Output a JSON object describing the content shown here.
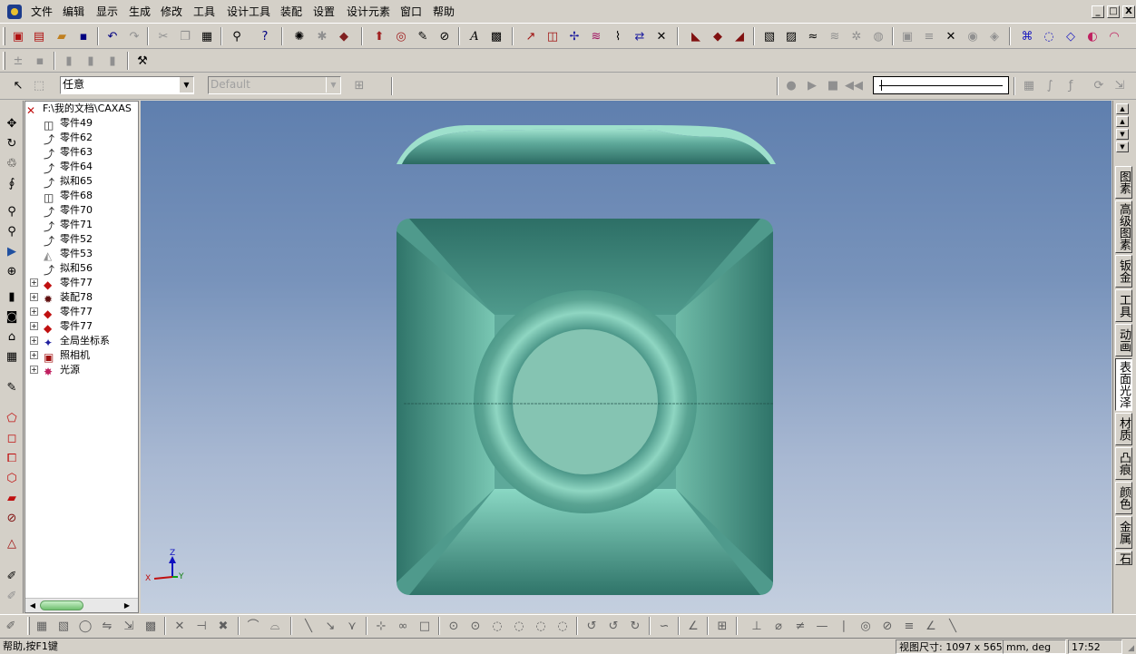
{
  "menu": [
    "文件",
    "编辑",
    "显示",
    "生成",
    "修改",
    "工具",
    "设计工具",
    "装配",
    "设置",
    "设计元素",
    "窗口",
    "帮助"
  ],
  "window_buttons": [
    "_",
    "□",
    "X"
  ],
  "toolbar3": {
    "filter_value": "任意",
    "style_value": "Default"
  },
  "tree": {
    "root": "F:\\我的文档\\CAXAS",
    "items": [
      {
        "label": "零件49",
        "icon": "part-outline-icon"
      },
      {
        "label": "零件62",
        "icon": "part-line-icon"
      },
      {
        "label": "零件63",
        "icon": "part-line-icon"
      },
      {
        "label": "零件64",
        "icon": "part-line-icon"
      },
      {
        "label": "拟和65",
        "icon": "part-line-icon"
      },
      {
        "label": "零件68",
        "icon": "part-outline-icon"
      },
      {
        "label": "零件70",
        "icon": "part-line-icon"
      },
      {
        "label": "零件71",
        "icon": "part-line-icon"
      },
      {
        "label": "零件52",
        "icon": "part-line-icon"
      },
      {
        "label": "零件53",
        "icon": "part-gray-icon"
      },
      {
        "label": "拟和56",
        "icon": "part-line-icon"
      },
      {
        "label": "零件77",
        "icon": "red-part-icon"
      },
      {
        "label": "装配78",
        "icon": "assembly-icon"
      },
      {
        "label": "零件77",
        "icon": "red-part-icon"
      },
      {
        "label": "零件77",
        "icon": "red-part-icon"
      },
      {
        "label": "全局坐标系",
        "icon": "coordinate-system-icon"
      },
      {
        "label": "照相机",
        "icon": "camera-icon"
      },
      {
        "label": "光源",
        "icon": "light-source-icon"
      }
    ]
  },
  "axis_labels": {
    "z": "Z",
    "x": "X",
    "y": "Y"
  },
  "right_tabs": [
    "图素",
    "高级图素",
    "钣金",
    "工具",
    "动画",
    "表面光泽",
    "材质",
    "凸痕",
    "颜色",
    "金属",
    "石"
  ],
  "active_tab": "表面光泽",
  "status": {
    "help": "帮助,按F1键",
    "view_size": "视图尺寸: 1097 x  565",
    "units": "mm, deg",
    "time": "17:52"
  },
  "colors": {
    "model": "#5ea99a",
    "background_top": "#5f7fae",
    "background_bottom": "#c4cfdf"
  }
}
